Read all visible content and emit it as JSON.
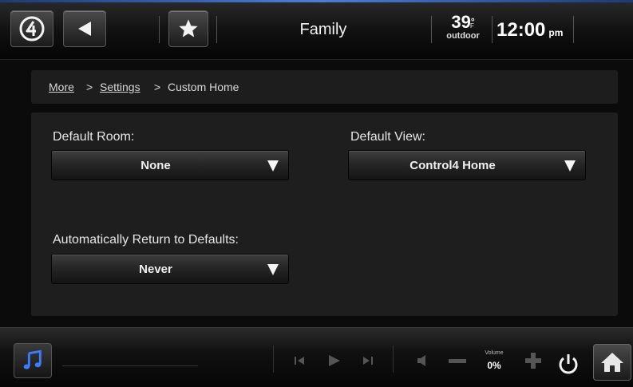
{
  "header": {
    "room": "Family",
    "temperature": "39",
    "temp_unit": "F",
    "temp_label": "outdoor",
    "time": "12:00",
    "ampm": "pm"
  },
  "breadcrumb": {
    "items": [
      "More",
      "Settings",
      "Custom Home"
    ],
    "separator": ">"
  },
  "settings": {
    "default_room_label": "Default Room:",
    "default_room_value": "None",
    "default_view_label": "Default View:",
    "default_view_value": "Control4 Home",
    "auto_return_label": "Automatically Return to Defaults:",
    "auto_return_value": "Never"
  },
  "footer": {
    "volume_label": "Volume",
    "volume_value": "0%"
  },
  "icons": [
    "control4-logo-icon",
    "back-arrow-icon",
    "star-icon",
    "music-note-icon",
    "skip-back-icon",
    "play-icon",
    "skip-forward-icon",
    "mute-icon",
    "volume-minus-icon",
    "volume-plus-icon",
    "power-icon",
    "home-icon",
    "dropdown-arrow-icon"
  ],
  "colors": {
    "accent_blue": "#4a7fd8",
    "panel": "#1e1e1e",
    "background": "#0b0b0b"
  }
}
